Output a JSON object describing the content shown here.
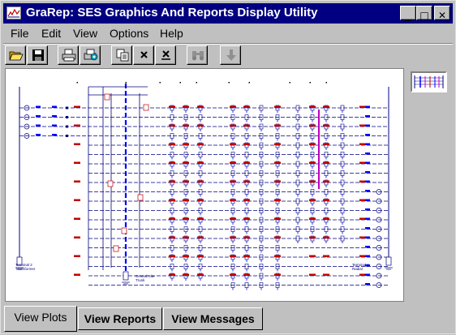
{
  "window": {
    "title": "GraRep: SES Graphics And Reports Display Utility"
  },
  "title_buttons": {
    "minimize": "_",
    "maximize": "□",
    "close": "✕"
  },
  "menu": [
    {
      "label": "File"
    },
    {
      "label": "Edit"
    },
    {
      "label": "View"
    },
    {
      "label": "Options"
    },
    {
      "label": "Help"
    }
  ],
  "toolbar": [
    {
      "icon": "open-folder-icon"
    },
    {
      "icon": "save-disk-icon"
    },
    {
      "icon": "print-icon"
    },
    {
      "icon": "print-setup-icon"
    },
    {
      "icon": "copy-icon"
    },
    {
      "icon": "delete-x-icon"
    },
    {
      "icon": "delete-x-underline-icon"
    },
    {
      "icon": "binoculars-icon"
    },
    {
      "icon": "down-arrow-icon"
    }
  ],
  "diagram": {
    "labels": {
      "left_terminal": "Terminal 2",
      "left_terminal_sub": "Transformer",
      "central_site": "Central Site",
      "central_site_sub": "Trunk",
      "right_terminal": "Terminal 1",
      "right_terminal_sub": "Radial"
    }
  },
  "tabs": [
    {
      "label": "View Plots",
      "active": true
    },
    {
      "label": "View Reports",
      "active": false
    },
    {
      "label": "View Messages",
      "active": false
    }
  ]
}
